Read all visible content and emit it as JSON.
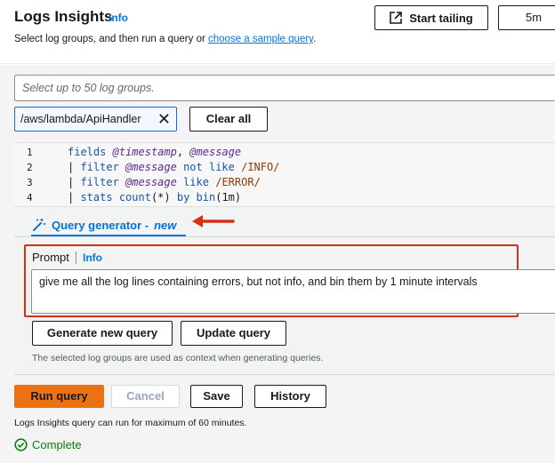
{
  "header": {
    "title": "Logs Insights",
    "info": "Info",
    "description_prefix": "Select log groups, and then run a query or ",
    "description_link": "choose a sample query",
    "description_suffix": ".",
    "start_tailing": "Start tailing",
    "time_range": "5m"
  },
  "log_groups": {
    "placeholder": "Select up to 50 log groups.",
    "selected": "/aws/lambda/ApiHandler",
    "clear_all": "Clear all"
  },
  "editor": {
    "line_numbers": [
      "1",
      "2",
      "3",
      "4"
    ]
  },
  "query_generator": {
    "tab_label": "Query generator - ",
    "tab_badge": "new",
    "prompt_label": "Prompt",
    "prompt_info": "Info",
    "prompt_text": "give me all the log lines containing errors, but not info, and bin them by 1 minute intervals",
    "generate_button": "Generate new query",
    "update_button": "Update query",
    "context_note": "The selected log groups are used as context when generating queries."
  },
  "actions": {
    "run": "Run query",
    "cancel": "Cancel",
    "save": "Save",
    "history": "History",
    "max_note": "Logs Insights query can run for maximum of 60 minutes.",
    "status": "Complete"
  },
  "colors": {
    "accent": "#0972d3",
    "primary_button": "#ec7211",
    "annotation": "#d13212",
    "success": "#037f0c"
  }
}
